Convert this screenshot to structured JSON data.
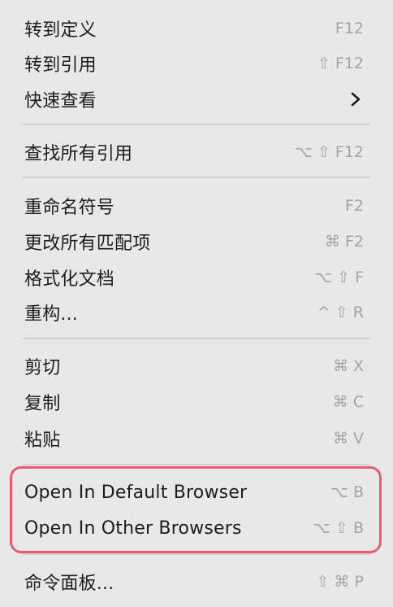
{
  "menu": {
    "items": [
      {
        "label": "转到定义",
        "shortcut": "F12"
      },
      {
        "label": "转到引用",
        "shortcut": "⇧ F12"
      },
      {
        "label": "快速查看",
        "submenu_icon": "chevron-right-icon"
      },
      {
        "label": "查找所有引用",
        "shortcut": "⌥ ⇧ F12"
      },
      {
        "label": "重命名符号",
        "shortcut": "F2"
      },
      {
        "label": "更改所有匹配项",
        "shortcut": "⌘ F2"
      },
      {
        "label": "格式化文档",
        "shortcut": "⌥ ⇧ F"
      },
      {
        "label": "重构...",
        "shortcut": "^ ⇧ R"
      },
      {
        "label": "剪切",
        "shortcut": "⌘ X"
      },
      {
        "label": "复制",
        "shortcut": "⌘ C"
      },
      {
        "label": "粘贴",
        "shortcut": "⌘ V"
      },
      {
        "label": "Open In Default Browser",
        "shortcut": "⌥ B"
      },
      {
        "label": "Open In Other Browsers",
        "shortcut": "⌥ ⇧ B"
      },
      {
        "label": "命令面板...",
        "shortcut": "⇧ ⌘ P"
      }
    ]
  },
  "colors": {
    "menu_background": "#e8e8e8",
    "label_text": "#1d1d1d",
    "shortcut_text": "#a3a3a3",
    "separator": "#cfcfcf",
    "highlight_border": "#ec5a6d"
  }
}
